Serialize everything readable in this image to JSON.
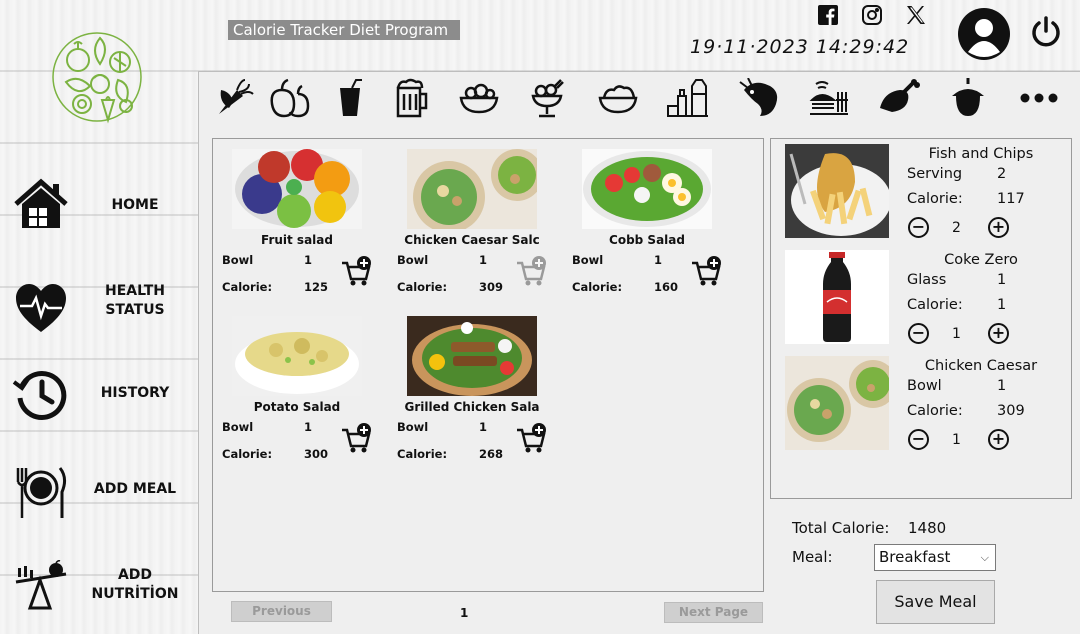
{
  "app": {
    "title": "Calorie Tracker Diet Program",
    "datetime": "19·11·2023  14:29:42"
  },
  "header": {
    "social": [
      "facebook-icon",
      "instagram-icon",
      "x-icon"
    ],
    "user_icon": "user-icon",
    "power_icon": "power-icon"
  },
  "sidebar": {
    "logo": "fruits-vegetables-logo",
    "items": [
      {
        "label_1": "HOME",
        "label_2": "",
        "icon": "home-icon"
      },
      {
        "label_1": "HEALTH",
        "label_2": "STATUS",
        "icon": "heart-pulse-icon"
      },
      {
        "label_1": "HISTORY",
        "label_2": "",
        "icon": "history-icon"
      },
      {
        "label_1": "ADD MEAL",
        "label_2": "",
        "icon": "plate-cutlery-icon"
      },
      {
        "label_1": "ADD",
        "label_2": "NUTRİTİON",
        "icon": "scale-apple-icon"
      }
    ]
  },
  "categories": [
    "vegetables-icon",
    "fruits-icon",
    "drink-icon",
    "beer-icon",
    "salad-bowl-icon",
    "dessert-icon",
    "salad-icon",
    "grocery-icon",
    "seafood-icon",
    "fast-food-icon",
    "meat-icon",
    "nuts-icon",
    "more-icon"
  ],
  "meals": [
    {
      "name": "Fruit salad",
      "unit": "Bowl",
      "qty": "1",
      "calorie_label": "Calorie:",
      "calorie": "125"
    },
    {
      "name": "Chicken Caesar Salc",
      "unit": "Bowl",
      "qty": "1",
      "calorie_label": "Calorie:",
      "calorie": "309"
    },
    {
      "name": "Cobb Salad",
      "unit": "Bowl",
      "qty": "1",
      "calorie_label": "Calorie:",
      "calorie": "160"
    },
    {
      "name": "Potato Salad",
      "unit": "Bowl",
      "qty": "1",
      "calorie_label": "Calorie:",
      "calorie": "300"
    },
    {
      "name": "Grilled Chicken Sala",
      "unit": "Bowl",
      "qty": "1",
      "calorie_label": "Calorie:",
      "calorie": "268"
    }
  ],
  "pagination": {
    "previous": "Previous",
    "page": "1",
    "next": "Next Page"
  },
  "selected": [
    {
      "name": "Fish and Chips",
      "unit": "Serving",
      "unit_qty": "2",
      "calorie_label": "Calorie:",
      "calorie": "117",
      "qty": "2"
    },
    {
      "name": "Coke Zero",
      "unit": "Glass",
      "unit_qty": "1",
      "calorie_label": "Calorie:",
      "calorie": "1",
      "qty": "1"
    },
    {
      "name": "Chicken Caesar",
      "unit": "Bowl",
      "unit_qty": "1",
      "calorie_label": "Calorie:",
      "calorie": "309",
      "qty": "1"
    }
  ],
  "summary": {
    "total_label": "Total Calorie:",
    "total_value": "1480",
    "meal_label": "Meal:",
    "meal_value": "Breakfast",
    "save_label": "Save Meal"
  },
  "colors": {
    "accent_green": "#7cb342",
    "title_bar": "#8c8c8c",
    "panel_bg": "#efefef"
  }
}
